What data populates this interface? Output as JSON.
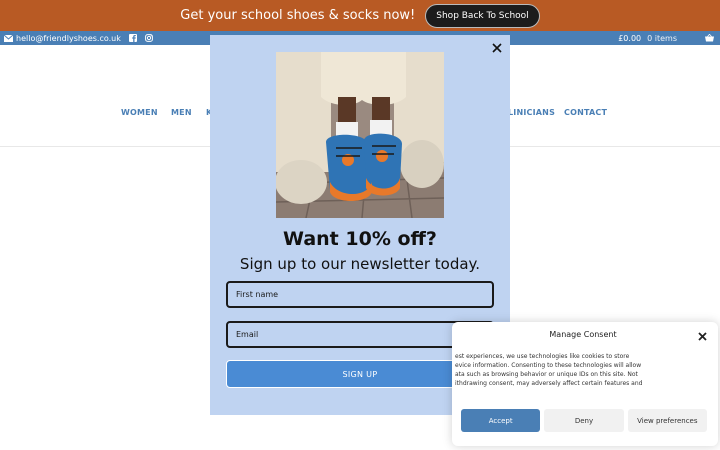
{
  "promo": {
    "text": "Get your school shoes & socks now!",
    "button": "Shop Back To School"
  },
  "infobar": {
    "email": "hello@friendlyshoes.co.uk",
    "cart_total": "£0.00",
    "cart_items": "0 items",
    "icons": [
      "envelope-icon",
      "facebook-icon",
      "instagram-icon",
      "basket-icon"
    ]
  },
  "nav": {
    "items": [
      {
        "label": "WOMEN"
      },
      {
        "label": "MEN"
      },
      {
        "label": "K"
      },
      {
        "label": "LINICIANS"
      },
      {
        "label": "CONTACT"
      }
    ]
  },
  "popup": {
    "title": "Want 10% off?",
    "subtitle": "Sign up to our newsletter today.",
    "first_name_placeholder": "First name",
    "email_placeholder": "Email",
    "signup_label": "SIGN UP"
  },
  "consent": {
    "title": "Manage Consent",
    "body": "est experiences, we use technologies like cookies to store\nevice information. Consenting to these technologies will allow\nata such as browsing behavior or unique IDs on this site. Not\nithdrawing consent, may adversely affect certain features and",
    "accept": "Accept",
    "deny": "Deny",
    "preferences": "View preferences"
  },
  "colors": {
    "promo_bg": "#b85a24",
    "brand_blue": "#4a7fb5",
    "popup_bg": "#bfd3f1",
    "signup_bg": "#4a8bd4"
  }
}
